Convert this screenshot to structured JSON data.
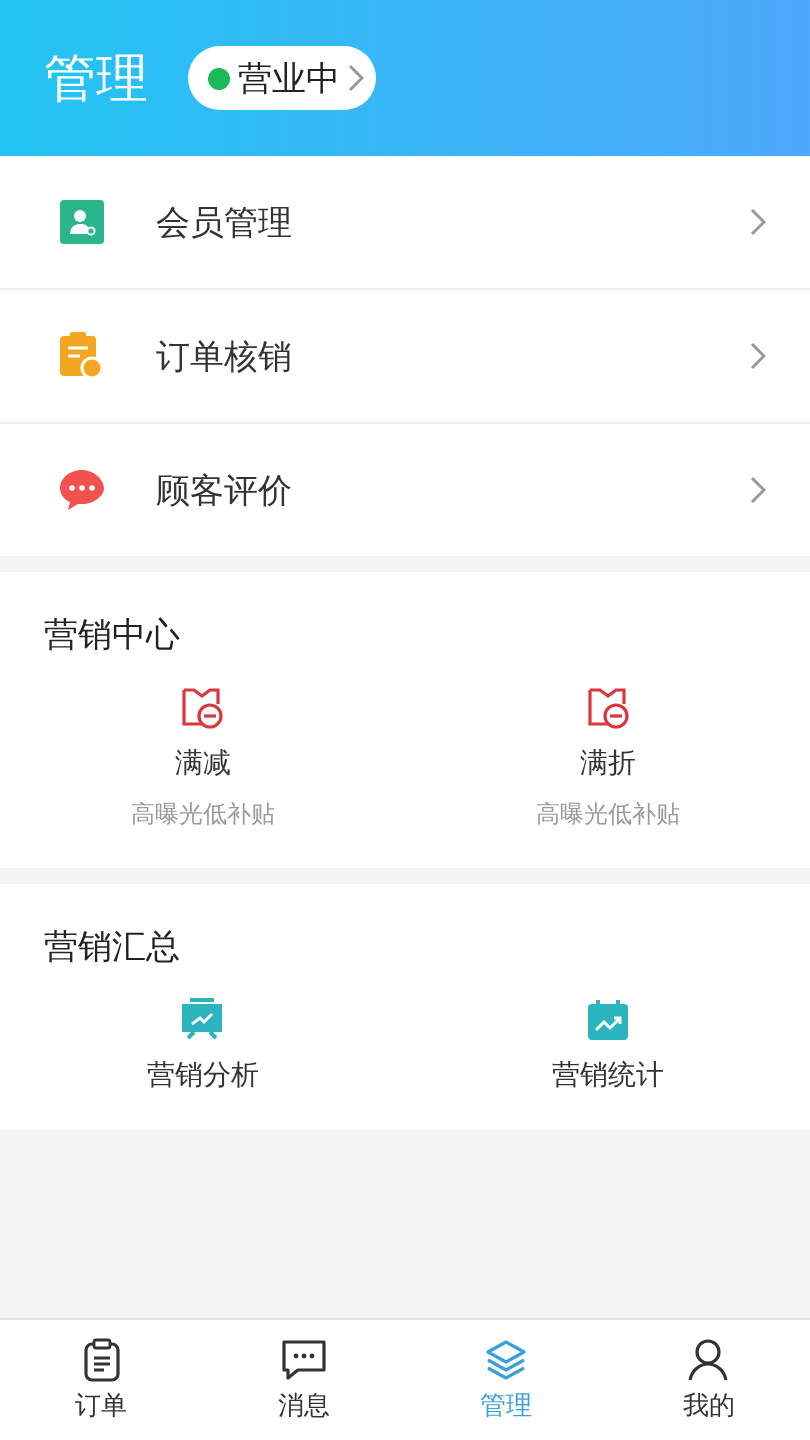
{
  "header": {
    "title": "管理",
    "status": {
      "label": "营业中",
      "color": "#1db954"
    }
  },
  "menu": [
    {
      "label": "会员管理"
    },
    {
      "label": "订单核销"
    },
    {
      "label": "顾客评价"
    }
  ],
  "sections": [
    {
      "title": "营销中心",
      "items": [
        {
          "label": "满减",
          "sub": "高曝光低补贴"
        },
        {
          "label": "满折",
          "sub": "高曝光低补贴"
        }
      ]
    },
    {
      "title": "营销汇总",
      "items": [
        {
          "label": "营销分析"
        },
        {
          "label": "营销统计"
        }
      ]
    }
  ],
  "tabs": [
    {
      "label": "订单",
      "selected": false
    },
    {
      "label": "消息",
      "selected": false
    },
    {
      "label": "管理",
      "selected": true
    },
    {
      "label": "我的",
      "selected": false
    }
  ]
}
